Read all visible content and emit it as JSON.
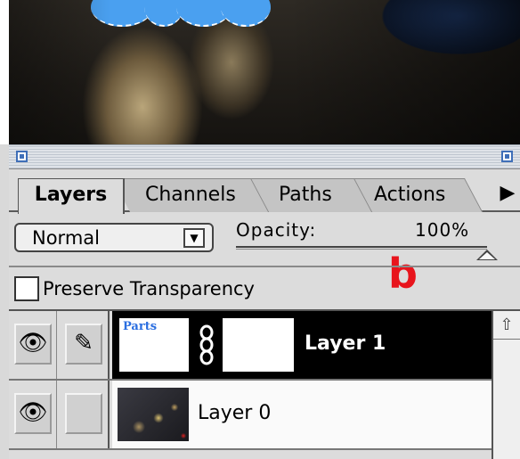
{
  "palette": {
    "tabs": [
      {
        "label": "Layers",
        "active": true
      },
      {
        "label": "Channels",
        "active": false
      },
      {
        "label": "Paths",
        "active": false
      },
      {
        "label": "Actions",
        "active": false
      }
    ],
    "menu_arrow": "▶",
    "blend_mode": "Normal",
    "blend_arrow": "▼",
    "opacity_label": "Opacity:",
    "opacity_value": "100%",
    "opacity_fraction": 1.0,
    "annotation": "b",
    "annotation_color": "#e8141c",
    "preserve_transparency_label": "Preserve Transparency",
    "preserve_transparency_checked": false,
    "layers": [
      {
        "name": "Layer 1",
        "selected": true,
        "mask_text": "Parts",
        "eye_icon": "eye-icon",
        "paint_icon": "paintbrush-icon",
        "link_icon": "chain-link-icon"
      },
      {
        "name": "Layer 0",
        "selected": false,
        "eye_icon": "eye-icon"
      }
    ],
    "scroll_up_arrow": "⇧"
  },
  "icons": {
    "eye": "👁",
    "brush": "✎",
    "link": "8"
  },
  "colors": {
    "selection_blue": "#4aa0f0",
    "selected_row": "#000000",
    "accent_box": "#3f6fb8"
  }
}
